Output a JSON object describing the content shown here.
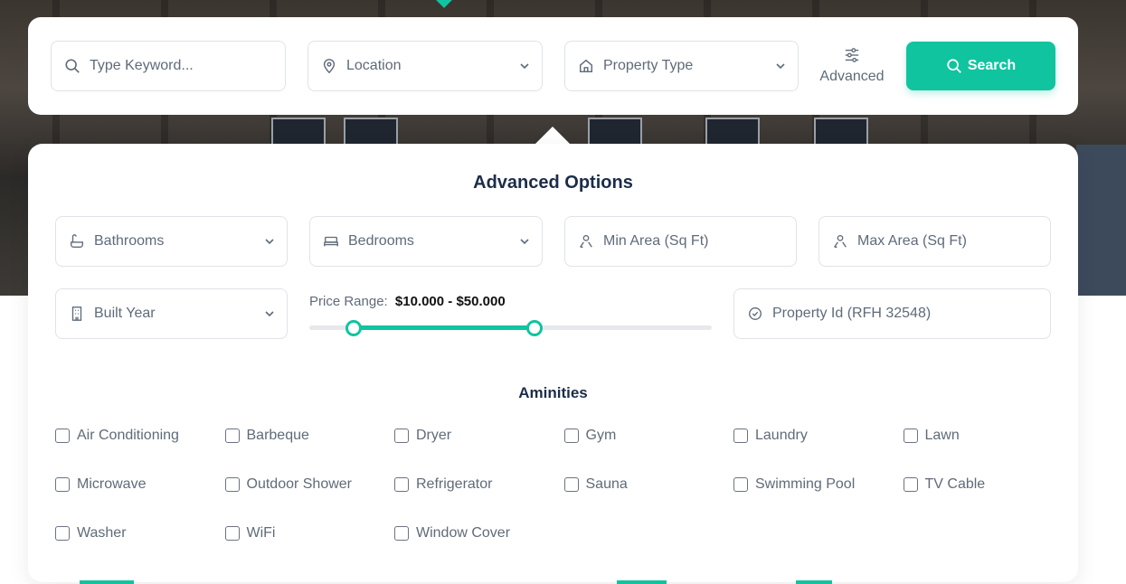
{
  "search": {
    "keyword_placeholder": "Type Keyword...",
    "location_label": "Location",
    "property_type_label": "Property Type",
    "advanced_label": "Advanced",
    "search_label": "Search"
  },
  "advanced": {
    "title": "Advanced Options",
    "bathrooms_label": "Bathrooms",
    "bedrooms_label": "Bedrooms",
    "min_area_placeholder": "Min Area (Sq Ft)",
    "max_area_placeholder": "Max Area (Sq Ft)",
    "built_year_label": "Built Year",
    "price_range_label": "Price Range:",
    "price_range_value": "$10.000 - $50.000",
    "price_range_fraction": [
      0.11,
      0.56
    ],
    "property_id_placeholder": "Property Id (RFH 32548)"
  },
  "amenities": {
    "title": "Aminities",
    "items": [
      "Air Conditioning",
      "Barbeque",
      "Dryer",
      "Gym",
      "Laundry",
      "Lawn",
      "Microwave",
      "Outdoor Shower",
      "Refrigerator",
      "Sauna",
      "Swimming Pool",
      "TV Cable",
      "Washer",
      "WiFi",
      "Window Cover"
    ]
  },
  "colors": {
    "accent": "#10c4a0",
    "heading": "#1b2d4a",
    "text": "#5f6b7a",
    "border": "#dfe3e8"
  }
}
